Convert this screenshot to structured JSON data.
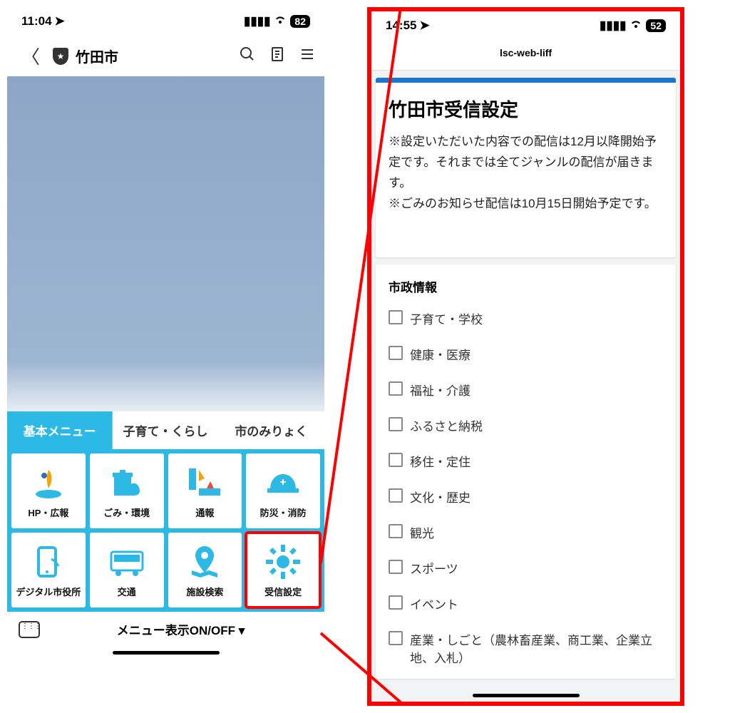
{
  "left": {
    "status": {
      "time": "11:04",
      "battery": "82"
    },
    "header": {
      "title": "竹田市"
    },
    "tabs": [
      {
        "label": "基本メニュー",
        "active": true
      },
      {
        "label": "子育て・くらし",
        "active": false
      },
      {
        "label": "市のみりょく",
        "active": false
      }
    ],
    "tiles": [
      {
        "label": "HP・広報",
        "icon": "logo"
      },
      {
        "label": "ごみ・環境",
        "icon": "trash"
      },
      {
        "label": "通報",
        "icon": "report"
      },
      {
        "label": "防災・消防",
        "icon": "helmet"
      },
      {
        "label": "デジタル市役所",
        "icon": "mobile"
      },
      {
        "label": "交通",
        "icon": "bus"
      },
      {
        "label": "施設検索",
        "icon": "pin"
      },
      {
        "label": "受信設定",
        "icon": "gear",
        "highlight": true
      }
    ],
    "menu_toggle": "メニュー表示ON/OFF ▾"
  },
  "right": {
    "status": {
      "time": "14:55",
      "battery": "52"
    },
    "web_title": "lsc-web-liff",
    "card": {
      "title": "竹田市受信設定",
      "desc": "※設定いただいた内容での配信は12月以降開始予定です。それまでは全てジャンルの配信が届きます。\n※ごみのお知らせ配信は10月15日開始予定です。"
    },
    "section": {
      "title": "市政情報",
      "items": [
        "子育て・学校",
        "健康・医療",
        "福祉・介護",
        "ふるさと納税",
        "移住・定住",
        "文化・歴史",
        "観光",
        "スポーツ",
        "イベント",
        "産業・しごと（農林畜産業、商工業、企業立地、入札）"
      ]
    }
  }
}
